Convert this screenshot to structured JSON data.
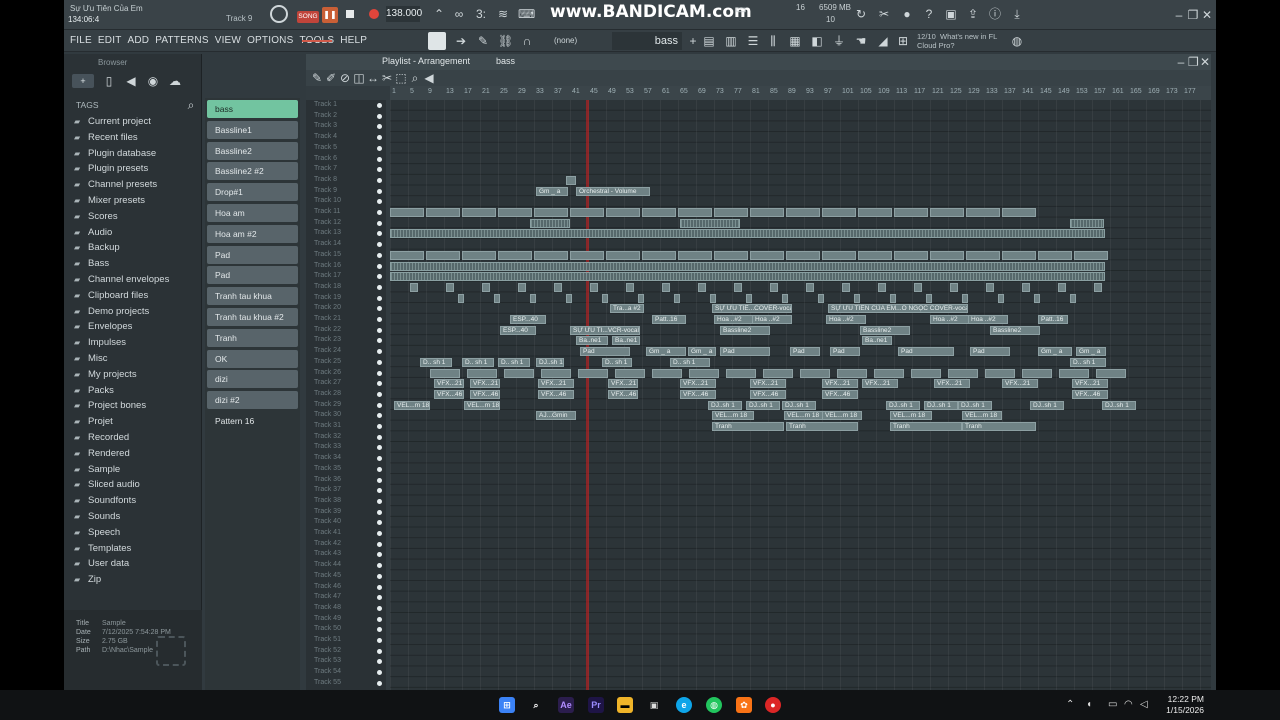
{
  "window": {
    "title": "Sự Ưu Tiên Của Em",
    "pattern_name": "Track 9",
    "song_label": "SONG",
    "time": "134:06:4",
    "tempo": "138.000",
    "watermark": "www.BANDICAM.com",
    "cpu": "16",
    "mem": "6509 MB",
    "poly": "10",
    "hint_count": "12/10",
    "hint_text": "What's new in FL",
    "hint_text2": "Cloud Pro?"
  },
  "menu": {
    "items": [
      "FILE",
      "EDIT",
      "ADD",
      "PATTERNS",
      "VIEW",
      "OPTIONS",
      "TOOLS",
      "HELP"
    ],
    "snap": "(none)",
    "pattern": "bass"
  },
  "browser": {
    "title": "Browser",
    "tags": "TAGS",
    "items": [
      "Current project",
      "Recent files",
      "Plugin database",
      "Plugin presets",
      "Channel presets",
      "Mixer presets",
      "Scores",
      "Audio",
      "Backup",
      "Bass",
      "Channel envelopes",
      "Clipboard files",
      "Demo projects",
      "Envelopes",
      "Impulses",
      "Misc",
      "My projects",
      "Packs",
      "Project bones",
      "Projet",
      "Recorded",
      "Rendered",
      "Sample",
      "Sliced audio",
      "Soundfonts",
      "Sounds",
      "Speech",
      "Templates",
      "User data",
      "Zip"
    ],
    "info": {
      "title_k": "Title",
      "title_v": "Sample",
      "date_k": "Date",
      "date_v": "7/12/2025 7:54:28 PM",
      "size_k": "Size",
      "size_v": "2.75 GB",
      "path_k": "Path",
      "path_v": "D:\\Nhac\\Sample"
    }
  },
  "patterns": [
    "bass",
    "Bassline1",
    "Bassline2",
    "Bassline2 #2",
    "Drop#1",
    "Hoa am",
    "Hoa am #2",
    "Pad",
    "Pad",
    "Tranh tau khua",
    "Tranh tau khua #2",
    "Tranh",
    "OK",
    "dizi",
    "dizi #2",
    "Pattern 16"
  ],
  "playlist": {
    "title": "Playlist - Arrangement",
    "crumb": "bass",
    "ruler": [
      "1",
      "5",
      "9",
      "13",
      "17",
      "21",
      "25",
      "29",
      "33",
      "37",
      "41",
      "45",
      "49",
      "53",
      "57",
      "61",
      "65",
      "69",
      "73",
      "77",
      "81",
      "85",
      "89",
      "93",
      "97",
      "101",
      "105",
      "109",
      "113",
      "117",
      "121",
      "125",
      "129",
      "133",
      "137",
      "141",
      "145",
      "149",
      "153",
      "157",
      "161",
      "165",
      "169",
      "173",
      "177"
    ]
  },
  "clips": {
    "gm": "Gm _ a",
    "orch": "Orchestral - Volume",
    "tra": "Tra...a #2",
    "su": "SỰ ƯU TIÊ...COVER-vocals",
    "su2": "SỰ ƯU TIÊN CỦA EM...Ô NGỌC COVER-vocals",
    "esp": "ESP...40",
    "su3": "SỰ ƯU TI...VCR-vocals",
    "hoa": "Hoa ..#2",
    "patt": "Patt..16",
    "bassl": "Bassline2",
    "bane": "Ba..ne1",
    "pad": "Pad",
    "dsh": "D.. sh 1",
    "vfx": "VFX...21",
    "vfx2": "VFX...46",
    "vel": "VEL...m 18",
    "dj": "DJ..sh 1",
    "aj": "AJ...Gmin",
    "tranh": "Tranh"
  },
  "taskbar": {
    "time": "12:22 PM",
    "date": "1/15/2026"
  }
}
